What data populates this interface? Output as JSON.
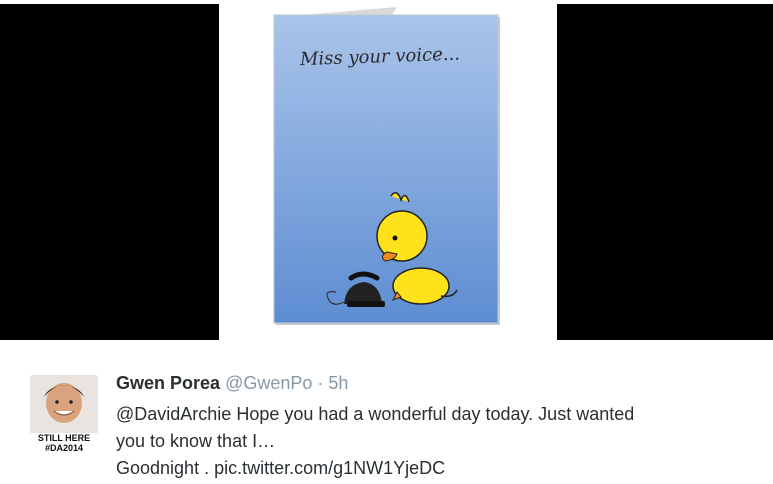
{
  "media": {
    "card_caption": "Miss your voice..."
  },
  "avatar": {
    "caption_line1": "STILL HERE",
    "caption_line2": "#DA2014"
  },
  "tweet": {
    "name": "Gwen Porea",
    "handle": "@GwenPo",
    "separator": "·",
    "time": "5h",
    "line1": "@DavidArchie Hope you had a wonderful day today. Just wanted",
    "line2": "you to know that I…",
    "line3": "Goodnight . pic.twitter.com/g1NW1YjeDC"
  },
  "colors": {
    "media_background": "#000000",
    "card_blue": "#7fa6df",
    "handle_gray": "#8899a6",
    "text_dark": "#292f33"
  }
}
